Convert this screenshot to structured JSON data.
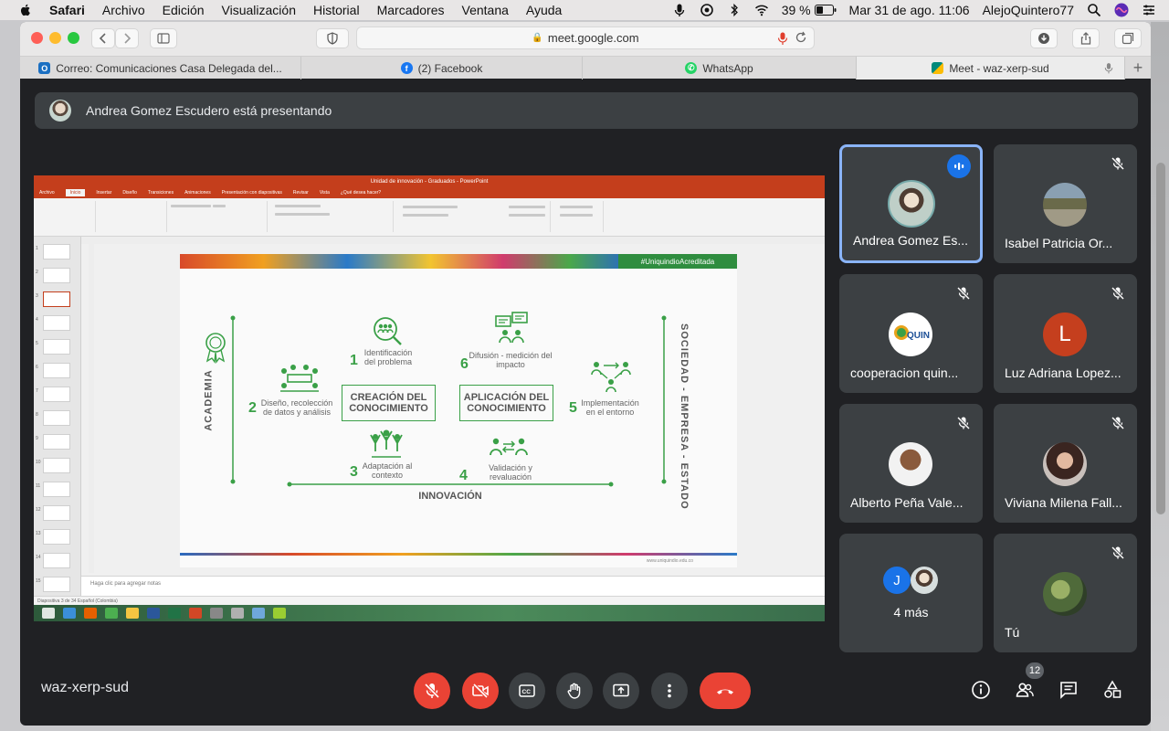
{
  "menubar": {
    "app": "Safari",
    "items": [
      "Archivo",
      "Edición",
      "Visualización",
      "Historial",
      "Marcadores",
      "Ventana",
      "Ayuda"
    ],
    "battery": "39 %",
    "datetime": "Mar 31 de ago.  11:06",
    "user": "AlejoQuintero77"
  },
  "browser": {
    "url": "meet.google.com",
    "tabs": [
      {
        "label": "Correo: Comunicaciones Casa Delegada del...",
        "icon": "outlook-icon",
        "color": "#1a6fc2"
      },
      {
        "label": "(2) Facebook",
        "icon": "facebook-icon",
        "color": "#1877f2"
      },
      {
        "label": "WhatsApp",
        "icon": "whatsapp-icon",
        "color": "#25d366"
      },
      {
        "label": "Meet - waz-xerp-sud",
        "icon": "meet-icon",
        "color": "#00897b"
      }
    ]
  },
  "meet": {
    "presenting_text": "Andrea Gomez Escudero está presentando",
    "meeting_code": "waz-xerp-sud",
    "participants_count": "12",
    "tiles": [
      {
        "name": "Andrea Gomez Es...",
        "state": "speaking"
      },
      {
        "name": "Isabel Patricia Or...",
        "state": "muted"
      },
      {
        "name": "cooperacion quin...",
        "state": "muted"
      },
      {
        "name": "Luz Adriana Lopez...",
        "state": "muted",
        "initial": "L"
      },
      {
        "name": "Alberto Peña Vale...",
        "state": "muted"
      },
      {
        "name": "Viviana Milena Fall...",
        "state": "muted"
      },
      {
        "name": "4 más",
        "initial": "J"
      },
      {
        "name": "Tú",
        "state": "muted"
      }
    ]
  },
  "slide": {
    "hashtag": "#UniquindioAcreditada",
    "academia": "ACADEMIA",
    "sociedad": "SOCIEDAD  -  EMPRESA  -  ESTADO",
    "innovacion": "INNOVACIÓN",
    "creacion": "CREACIÓN DEL CONOCIMIENTO",
    "aplicacion": "APLICACIÓN DEL CONOCIMIENTO",
    "steps": [
      {
        "n": "1",
        "label": "Identificación del problema"
      },
      {
        "n": "2",
        "label": "Diseño, recolección de datos y análisis"
      },
      {
        "n": "3",
        "label": "Adaptación al contexto"
      },
      {
        "n": "4",
        "label": "Validación y revaluación"
      },
      {
        "n": "5",
        "label": "Implementación en el entorno"
      },
      {
        "n": "6",
        "label": "Difusión - medición del impacto"
      }
    ],
    "footer_url": "www.uniquindio.edu.co",
    "notes": "Haga clic para agregar notas",
    "ppt_title": "Unidad de innovación - Graduados - PowerPoint",
    "ppt_tabs": [
      "Archivo",
      "Inicio",
      "Insertar",
      "Diseño",
      "Transiciones",
      "Animaciones",
      "Presentación con diapositivas",
      "Revisar",
      "Vista",
      "¿Qué desea hacer?"
    ],
    "status": "Diapositiva 3 de 34   Español (Colombia)"
  }
}
